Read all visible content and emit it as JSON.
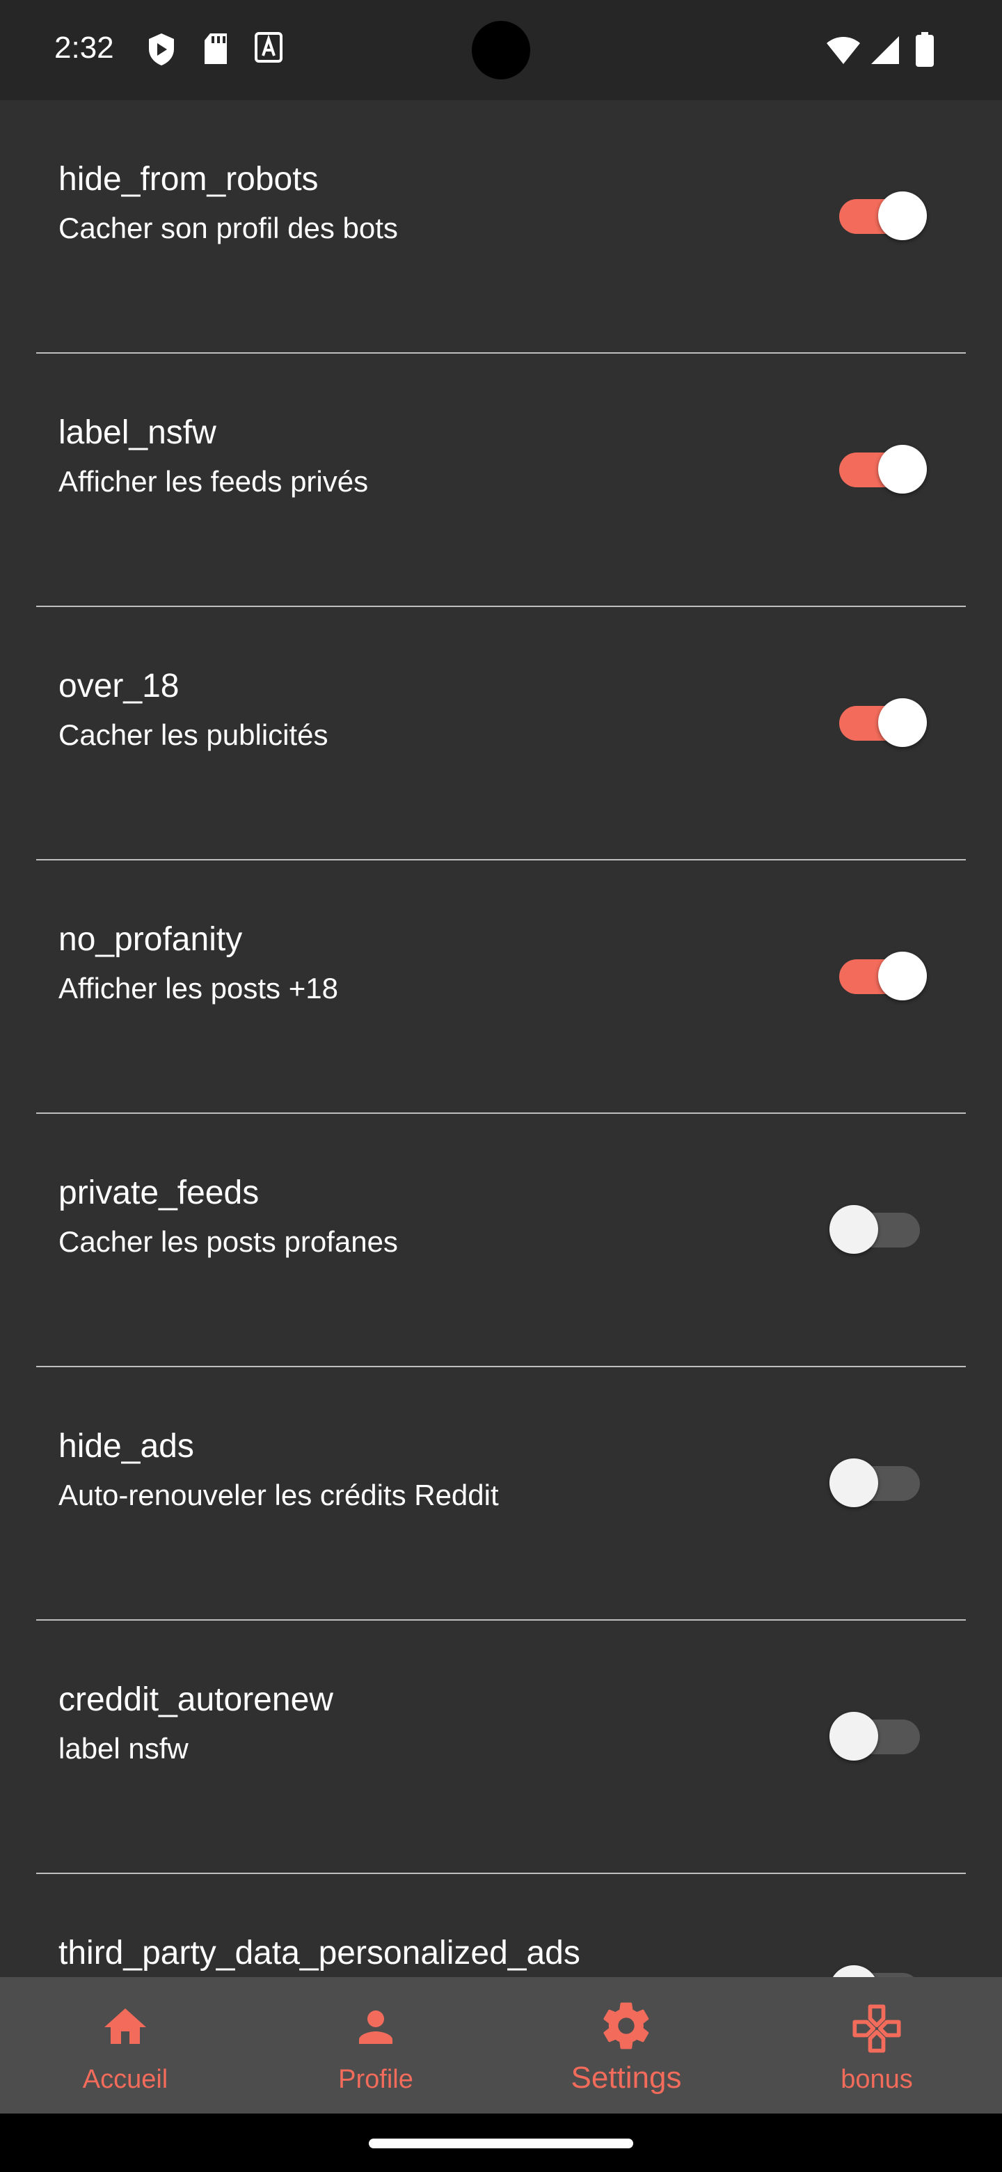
{
  "status_bar": {
    "time": "2:32",
    "icons": [
      "shield-icon",
      "sd-card-icon",
      "text-a-icon",
      "wifi-icon",
      "signal-icon",
      "battery-icon"
    ]
  },
  "colors": {
    "accent": "#f26b5b",
    "background": "#303030",
    "nav_background": "#4d4d4d"
  },
  "settings": [
    {
      "title": "hide_from_robots",
      "description": "Cacher son profil des bots",
      "enabled": true
    },
    {
      "title": "label_nsfw",
      "description": "Afficher les feeds privés",
      "enabled": true
    },
    {
      "title": "over_18",
      "description": "Cacher les publicités",
      "enabled": true
    },
    {
      "title": "no_profanity",
      "description": "Afficher les posts +18",
      "enabled": true
    },
    {
      "title": "private_feeds",
      "description": "Cacher les posts profanes",
      "enabled": false
    },
    {
      "title": "hide_ads",
      "description": "Auto-renouveler les crédits Reddit",
      "enabled": false
    },
    {
      "title": "creddit_autorenew",
      "description": "label nsfw",
      "enabled": false
    },
    {
      "title": "third_party_data_personalized_ads",
      "description": "",
      "enabled": false
    }
  ],
  "bottom_nav": {
    "items": [
      {
        "label": "Accueil",
        "icon": "home-icon"
      },
      {
        "label": "Profile",
        "icon": "person-icon"
      },
      {
        "label": "Settings",
        "icon": "gear-icon",
        "active": true
      },
      {
        "label": "bonus",
        "icon": "gamepad-icon"
      }
    ]
  }
}
